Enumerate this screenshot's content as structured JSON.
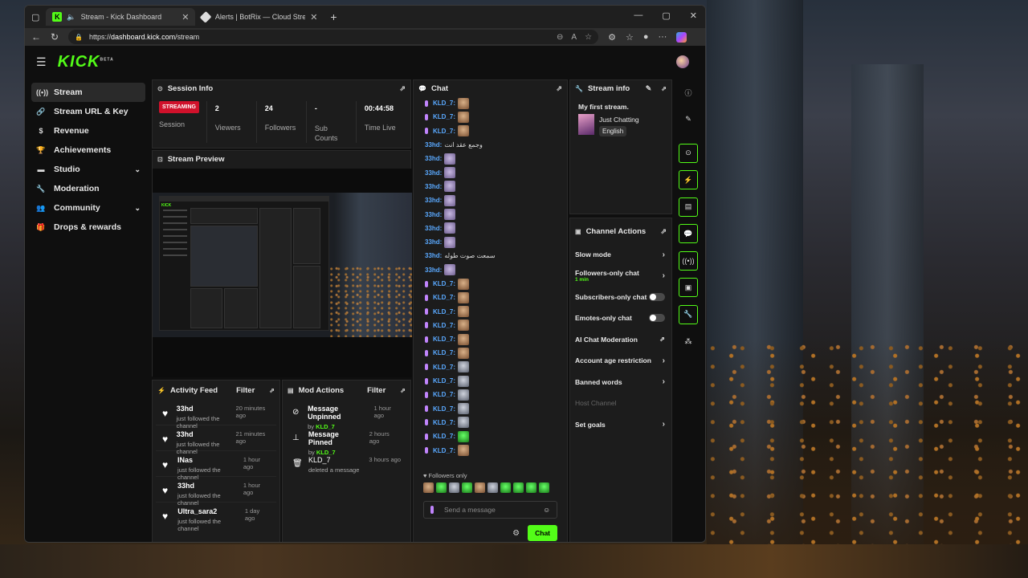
{
  "browser": {
    "tabs": [
      {
        "title": "Stream - Kick Dashboard",
        "active": true
      },
      {
        "title": "Alerts | BotRix — Cloud Streaming",
        "active": false
      }
    ],
    "url_scheme": "https://",
    "url_host": "dashboard.kick.com",
    "url_path": "/stream"
  },
  "app": {
    "logo": "KICK",
    "logo_sup": "BETA",
    "accent": "#53fc18"
  },
  "sidebar": {
    "items": [
      {
        "label": "Stream",
        "icon": "broadcast-icon",
        "active": true
      },
      {
        "label": "Stream URL & Key",
        "icon": "link-icon"
      },
      {
        "label": "Revenue",
        "icon": "dollar-icon"
      },
      {
        "label": "Achievements",
        "icon": "trophy-icon"
      },
      {
        "label": "Studio",
        "icon": "video-icon",
        "expandable": true
      },
      {
        "label": "Moderation",
        "icon": "wrench-icon"
      },
      {
        "label": "Community",
        "icon": "users-icon",
        "expandable": true
      },
      {
        "label": "Drops & rewards",
        "icon": "gift-icon"
      }
    ]
  },
  "session": {
    "title": "Session Info",
    "status_badge": "STREAMING",
    "status_label": "Session",
    "viewers": "2",
    "viewers_label": "Viewers",
    "followers": "24",
    "followers_label": "Followers",
    "subs": "-",
    "subs_label": "Sub Counts",
    "time": "00:44:58",
    "time_label": "Time Live"
  },
  "preview": {
    "title": "Stream Preview"
  },
  "activity": {
    "title": "Activity Feed",
    "filter": "Filter",
    "items": [
      {
        "name": "33hd",
        "text": "just followed the channel",
        "time": "20 minutes ago"
      },
      {
        "name": "33hd",
        "text": "just followed the channel",
        "time": "21 minutes ago"
      },
      {
        "name": "INas",
        "text": "just followed the channel",
        "time": "1 hour ago"
      },
      {
        "name": "33hd",
        "text": "just followed the channel",
        "time": "1 hour ago"
      },
      {
        "name": "Ultra_sara2",
        "text": "just followed the channel",
        "time": "1 day ago"
      }
    ]
  },
  "mod": {
    "title": "Mod Actions",
    "filter": "Filter",
    "items": [
      {
        "action": "Message Unpinned",
        "by": "by",
        "user": "KLD_7",
        "time": "1 hour ago",
        "icon": "unpin-icon"
      },
      {
        "action": "Message Pinned",
        "by": "by",
        "user": "KLD_7",
        "time": "2 hours ago",
        "icon": "pin-icon"
      },
      {
        "action": "KLD_7",
        "by": "deleted a message",
        "user": "",
        "time": "3 hours ago",
        "icon": "trash-icon"
      }
    ]
  },
  "chat": {
    "title": "Chat",
    "followers_only": "Followers only",
    "placeholder": "Send a message",
    "send": "Chat",
    "messages": [
      {
        "user": "KLD_7:",
        "mod": true,
        "emote": "cat"
      },
      {
        "user": "KLD_7:",
        "mod": true,
        "emote": "cat"
      },
      {
        "user": "KLD_7:",
        "mod": true,
        "emote": "cat"
      },
      {
        "user": "33hd:",
        "mod": false,
        "text": "وجمع عقد انت"
      },
      {
        "user": "33hd:",
        "mod": false,
        "emote": "meme"
      },
      {
        "user": "33hd:",
        "mod": false,
        "emote": "meme"
      },
      {
        "user": "33hd:",
        "mod": false,
        "emote": "meme"
      },
      {
        "user": "33hd:",
        "mod": false,
        "emote": "meme"
      },
      {
        "user": "33hd:",
        "mod": false,
        "emote": "meme"
      },
      {
        "user": "33hd:",
        "mod": false,
        "emote": "meme"
      },
      {
        "user": "33hd:",
        "mod": false,
        "emote": "meme"
      },
      {
        "user": "33hd:",
        "mod": false,
        "text": "سمعت صوت طوله"
      },
      {
        "user": "33hd:",
        "mod": false,
        "emote": "meme"
      },
      {
        "user": "KLD_7:",
        "mod": true,
        "emote": "cat"
      },
      {
        "user": "KLD_7:",
        "mod": true,
        "emote": "cat"
      },
      {
        "user": "KLD_7:",
        "mod": true,
        "emote": "cat"
      },
      {
        "user": "KLD_7:",
        "mod": true,
        "emote": "cat"
      },
      {
        "user": "KLD_7:",
        "mod": true,
        "emote": "cat"
      },
      {
        "user": "KLD_7:",
        "mod": true,
        "emote": "cat"
      },
      {
        "user": "KLD_7:",
        "mod": true,
        "emote": "gray"
      },
      {
        "user": "KLD_7:",
        "mod": true,
        "emote": "gray"
      },
      {
        "user": "KLD_7:",
        "mod": true,
        "emote": "gray"
      },
      {
        "user": "KLD_7:",
        "mod": true,
        "emote": "gray"
      },
      {
        "user": "KLD_7:",
        "mod": true,
        "emote": "gray"
      },
      {
        "user": "KLD_7:",
        "mod": true,
        "emote": "green"
      },
      {
        "user": "KLD_7:",
        "mod": true,
        "emote": "cat"
      }
    ]
  },
  "stream_info": {
    "title": "Stream info",
    "stream_title": "My first stream.",
    "category": "Just Chatting",
    "language": "English"
  },
  "channel_actions": {
    "title": "Channel Actions",
    "slow_mode": "Slow mode",
    "followers_only": "Followers-only chat",
    "followers_only_sub": "1 min",
    "subscribers_only": "Subscribers-only chat",
    "emotes_only": "Emotes-only chat",
    "ai_mod": "AI Chat Moderation",
    "age_restriction": "Account age restriction",
    "banned_words": "Banned words",
    "host_channel": "Host Channel",
    "set_goals": "Set goals"
  }
}
